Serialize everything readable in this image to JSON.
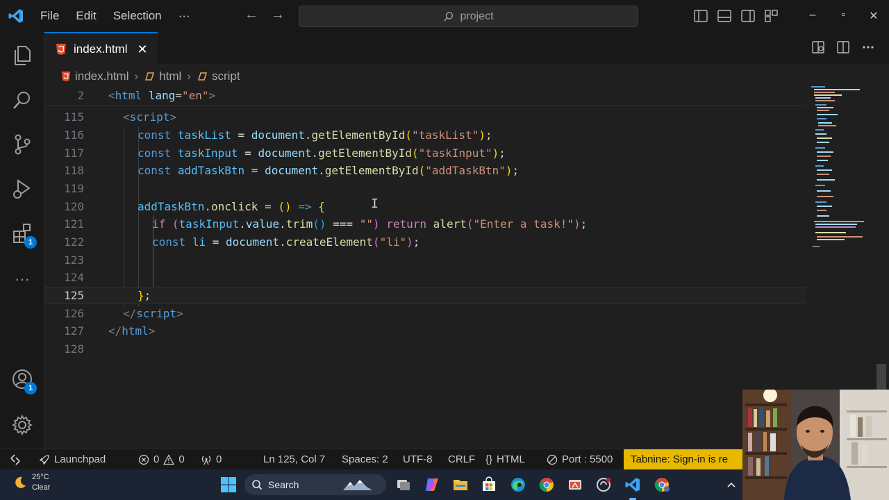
{
  "titlebar": {
    "menu": [
      "File",
      "Edit",
      "Selection",
      "···"
    ],
    "search_text": "project",
    "window_controls": [
      "–",
      "▫",
      "✕"
    ]
  },
  "activity_bar": {
    "extensions_badge": "1",
    "accounts_badge": "1",
    "more": "···"
  },
  "tab": {
    "label": "index.html",
    "close": "✕"
  },
  "breadcrumb": {
    "file": "index.html",
    "html": "html",
    "script": "script"
  },
  "sticky": {
    "ln": "2"
  },
  "line_numbers": [
    "115",
    "116",
    "117",
    "118",
    "119",
    "120",
    "121",
    "122",
    "123",
    "124",
    "125",
    "126",
    "127",
    "128"
  ],
  "statusbar": {
    "launchpad": "Launchpad",
    "errors": "0",
    "warnings": "0",
    "ports": "0",
    "position": "Ln 125, Col 7",
    "spaces": "Spaces: 2",
    "encoding": "UTF-8",
    "eol": "CRLF",
    "language": "HTML",
    "port": "Port : 5500",
    "tabnine": "Tabnine: Sign-in is re"
  },
  "taskbar": {
    "temperature": "25°C",
    "condition": "Clear",
    "search_label": "Search"
  },
  "colors": {
    "accent": "#0078d4",
    "tabnine": "#e6b800",
    "taskbar": "#1c2433"
  }
}
